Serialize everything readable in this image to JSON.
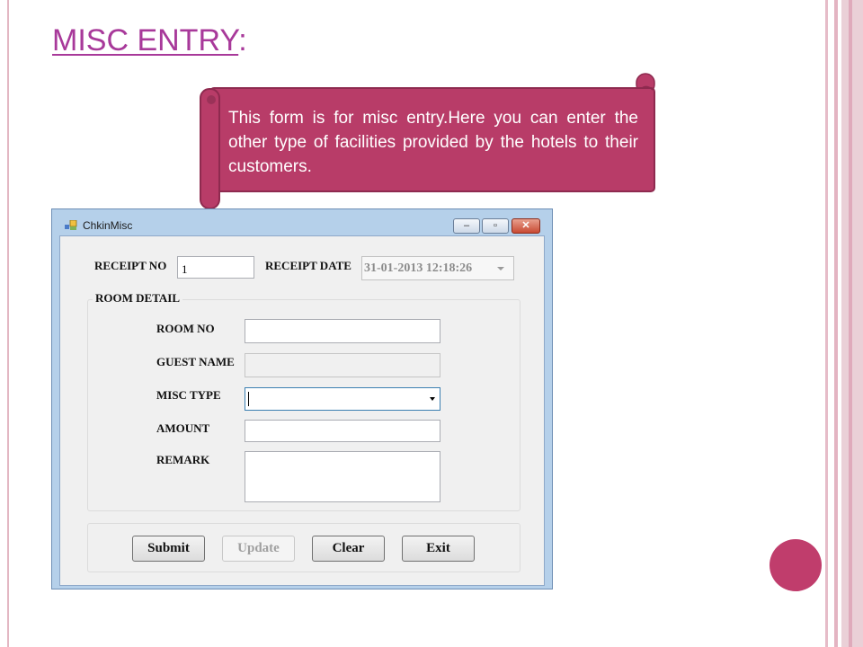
{
  "slide": {
    "title": "MISC ENTRY",
    "title_suffix": ":",
    "callout_text": "This form is for misc entry.Here you can enter the other type of facilities provided by the hotels to their customers."
  },
  "colors": {
    "title": "#a8399a",
    "banner": "#b83c68",
    "accent_circle": "#c03d6c",
    "window_frame": "#b5d0ea"
  },
  "window": {
    "title": "ChkinMisc",
    "controls": {
      "minimize": "–",
      "maximize": "▫",
      "close": "✕"
    }
  },
  "form": {
    "receipt_no_label": "RECEIPT NO",
    "receipt_no_value": "1",
    "receipt_date_label": "RECEIPT DATE",
    "receipt_date_value": "31-01-2013 12:18:26",
    "room_detail_label": "ROOM DETAIL",
    "room_no_label": "ROOM NO",
    "room_no_value": "",
    "guest_name_label": "GUEST NAME",
    "guest_name_value": "",
    "misc_type_label": "MISC TYPE",
    "misc_type_value": "",
    "amount_label": "AMOUNT",
    "amount_value": "",
    "remark_label": "REMARK",
    "remark_value": ""
  },
  "buttons": {
    "submit": "Submit",
    "update": "Update",
    "clear": "Clear",
    "exit": "Exit"
  }
}
